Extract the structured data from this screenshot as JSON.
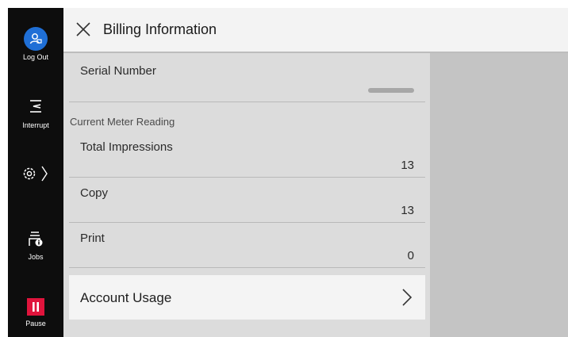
{
  "sidebar": {
    "logout": {
      "label": "Log Out",
      "icon": "user-logout-icon"
    },
    "interrupt": {
      "label": "Interrupt",
      "icon": "interrupt-icon"
    },
    "settings": {
      "icon": "gear-icon"
    },
    "jobs": {
      "label": "Jobs",
      "icon": "jobs-icon"
    },
    "pause": {
      "label": "Pause",
      "icon": "pause-icon"
    }
  },
  "header": {
    "title": "Billing Information",
    "close_icon": "close-icon"
  },
  "serial": {
    "label": "Serial Number"
  },
  "meter": {
    "section_title": "Current Meter Reading",
    "rows": [
      {
        "label": "Total Impressions",
        "value": "13"
      },
      {
        "label": "Copy",
        "value": "13"
      },
      {
        "label": "Print",
        "value": "0"
      }
    ]
  },
  "account": {
    "label": "Account Usage",
    "icon": "chevron-right-icon"
  },
  "colors": {
    "sidebar": "#0d0d0d",
    "accent_blue": "#1f6fd6",
    "pause_red": "#e0143c"
  }
}
